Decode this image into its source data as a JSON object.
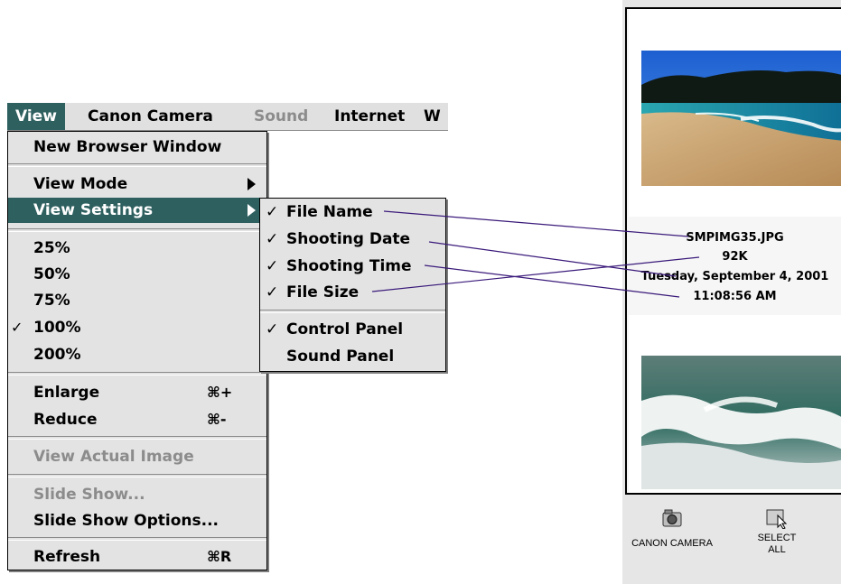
{
  "menubar": {
    "items": [
      {
        "label": "View",
        "state": "active"
      },
      {
        "label": "Canon Camera",
        "state": "normal"
      },
      {
        "label": "Sound",
        "state": "disabled"
      },
      {
        "label": "Internet",
        "state": "normal"
      },
      {
        "label": "W",
        "state": "normal"
      }
    ]
  },
  "view_menu": {
    "new_browser_window": "New Browser Window",
    "view_mode": "View Mode",
    "view_settings": "View Settings",
    "zoom_25": "25%",
    "zoom_50": "50%",
    "zoom_75": "75%",
    "zoom_100": "100%",
    "zoom_200": "200%",
    "enlarge": "Enlarge",
    "enlarge_shortcut": "⌘+",
    "reduce": "Reduce",
    "reduce_shortcut": "⌘-",
    "view_actual_image": "View Actual Image",
    "slide_show": "Slide Show...",
    "slide_show_options": "Slide Show Options...",
    "refresh": "Refresh",
    "refresh_shortcut": "⌘R",
    "checkmark": "✓"
  },
  "settings_submenu": {
    "file_name": "File Name",
    "shooting_date": "Shooting Date",
    "shooting_time": "Shooting Time",
    "file_size": "File Size",
    "control_panel": "Control Panel",
    "sound_panel": "Sound Panel",
    "checkmark": "✓"
  },
  "browser": {
    "image1": {
      "file_name": "SMPIMG35.JPG",
      "file_size": "92K",
      "shooting_date": "Tuesday, September 4, 2001",
      "shooting_time": "11:08:56 AM"
    },
    "toolbar": {
      "canon_camera": "CANON CAMERA",
      "select_all_line1": "SELECT",
      "select_all_line2": "ALL"
    }
  },
  "colors": {
    "highlight": "#2f6060",
    "callout_line": "#3a1a7a",
    "disabled_text": "#8c8c8c"
  }
}
